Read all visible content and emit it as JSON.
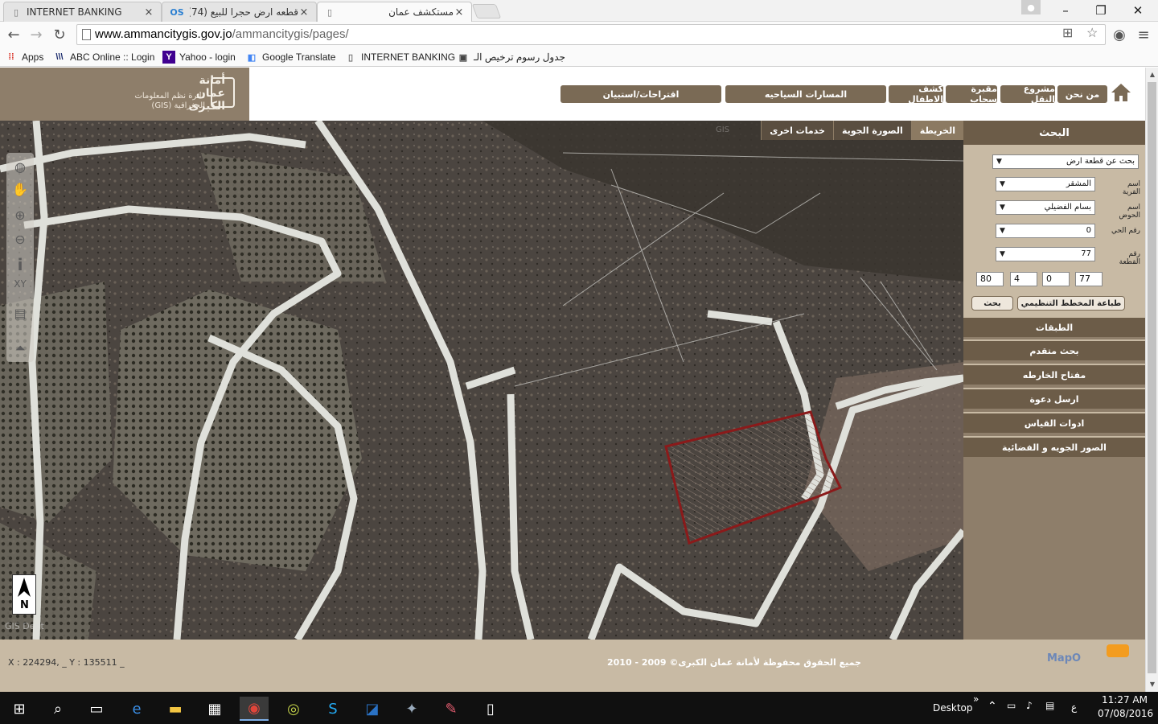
{
  "browser": {
    "tabs": [
      {
        "title": "INTERNET BANKING",
        "favicon": "page-icon"
      },
      {
        "title": "قطعه ارض حجرا للبيع (74)",
        "favicon": "opensooq-icon",
        "favicon_text": "OS"
      },
      {
        "title": "مستكشف عمان",
        "favicon": "page-icon"
      }
    ],
    "tab_close": "×",
    "window_controls": {
      "minimize": "–",
      "maximize": "❐",
      "close": "✕"
    },
    "url_host": "www.ammancitygis.gov.jo",
    "url_path": "/ammancitygis/pages/",
    "bookmarks": [
      {
        "label": "Apps",
        "icon": "apps-grid-icon"
      },
      {
        "label": "ABC Online :: Login",
        "icon": "abc-icon"
      },
      {
        "label": "Yahoo - login",
        "icon": "yahoo-icon",
        "icon_text": "Y"
      },
      {
        "label": "Google Translate",
        "icon": "google-translate-icon"
      },
      {
        "label": "INTERNET BANKING",
        "icon": "page-icon"
      },
      {
        "label": "جدول رسوم ترخيص الـ",
        "icon": "site-icon"
      }
    ]
  },
  "site": {
    "logo": {
      "name": "أمانة عمان الكبرى",
      "subtitle": "دائرة نظم المعلومات الجغرافية (GIS)"
    },
    "nav": [
      {
        "label": "من نحن"
      },
      {
        "label": "مشروع النقل"
      },
      {
        "label": "مقبرة سحاب"
      },
      {
        "label": "كشف الاطفال"
      },
      {
        "label": "المسارات السياحيه"
      },
      {
        "label": "اقتراحات/استبيان"
      }
    ]
  },
  "map": {
    "tabs": [
      {
        "label": "الخريطة",
        "active": true
      },
      {
        "label": "الصورة الجوية",
        "active": false
      },
      {
        "label": "خدمات اخرى",
        "active": false
      }
    ],
    "tools": [
      {
        "name": "globe-extent-icon"
      },
      {
        "name": "pan-hand-icon"
      },
      {
        "name": "zoom-in-icon"
      },
      {
        "name": "zoom-out-icon"
      },
      {
        "name": "identify-icon"
      },
      {
        "name": "xy-coordinates-icon",
        "label": "XY"
      },
      {
        "name": "print-icon"
      },
      {
        "name": "collapse-toolbar-icon"
      }
    ],
    "north_label": "N",
    "credit": "GIS Dept",
    "parcel_color": "#8b1a1a"
  },
  "search_panel": {
    "title": "البحث",
    "search_type": "بحث عن قطعة ارض",
    "fields": [
      {
        "label": "اسم القرية",
        "value": "المشقر"
      },
      {
        "label": "اسم الحوض",
        "value": "بسام الفضيلي"
      },
      {
        "label": "رقم الحي",
        "value": "0"
      },
      {
        "label": "رقم القطعة",
        "value": "77"
      }
    ],
    "numbers": [
      "80",
      "4",
      "0",
      "77"
    ],
    "search_button": "بحث",
    "print_button": "طباعة المخطط التنظيمي",
    "sections": [
      {
        "label": "الطبقات"
      },
      {
        "label": "بحث متقدم"
      },
      {
        "label": "مفتاح الخارطه"
      },
      {
        "label": "ارسل دعوة"
      },
      {
        "label": "ادوات القياس"
      },
      {
        "label": "الصور الجويه و الفضائية"
      }
    ]
  },
  "footer": {
    "coordinates": "X : 224294, _ Y : 135511 _",
    "copyright": "جميع الحقوق محفوظة لأمانة عمان الكبرى© 2009 - 2010",
    "map_brand": "MapO"
  },
  "taskbar": {
    "desktop_label": "Desktop",
    "overflow": "»",
    "language": "ع",
    "time": "11:27 AM",
    "date": "07/08/2016",
    "apps": [
      "windows-start-icon",
      "search-icon",
      "task-view-icon",
      "edge-icon",
      "file-explorer-icon",
      "store-icon",
      "chrome-icon",
      "app-icon",
      "skype-icon",
      "outlook-icon",
      "photos-icon",
      "paint-icon",
      "notepad-icon"
    ]
  }
}
